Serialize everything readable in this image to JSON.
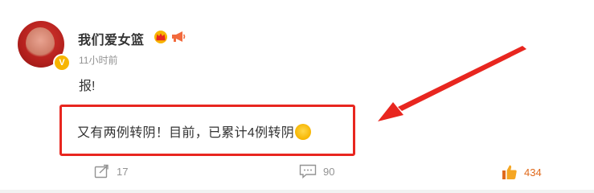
{
  "post": {
    "author": "我们爱女篮",
    "timestamp": "11小时前",
    "text": "报!",
    "quote_text": "又有两例转阴！目前，已累计4例转阴"
  },
  "icons": {
    "verified": "verified-v-icon",
    "crown": "crown-badge-icon",
    "horn": "megaphone-badge-icon",
    "emoji": "crying-emoji-icon",
    "repost": "share-icon",
    "comment": "comment-icon",
    "like": "thumbs-up-icon"
  },
  "verified_badge_text": "V",
  "actions": {
    "repost_count": "17",
    "comment_count": "90",
    "like_count": "434"
  },
  "colors": {
    "highlight": "#e8261f",
    "like": "#e06a1c",
    "muted": "#939393",
    "text": "#333333"
  }
}
